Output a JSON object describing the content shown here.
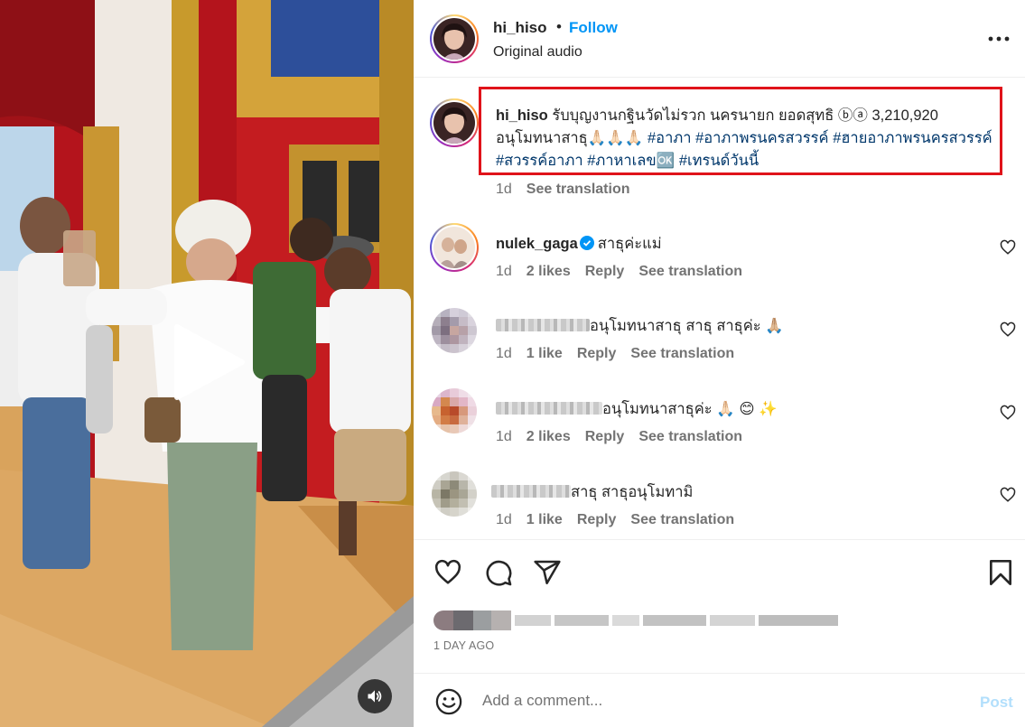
{
  "post": {
    "author": "hi_hiso",
    "follow_label": "Follow",
    "audio": "Original audio",
    "more_icon": "more-horizontal-icon"
  },
  "caption": {
    "username": "hi_hiso",
    "text": " รับบุญงานกฐินวัดไม่รวก นครนายก ยอดสุทธิ ⓑⓐ 3,210,920 อนุโมทนาสาธุ🙏🏻🙏🏻🙏🏻 ",
    "hashtags": [
      "#อาภา",
      "#อาภาพรนครสวรรค์",
      "#ฮายอาภาพรนครสวรรค์",
      "#สวรรค์อาภา",
      "#ภาหาเลข🆗",
      "#เทรนด์วันนี้"
    ],
    "time": "1d",
    "see_translation": "See translation",
    "highlight_color": "#e0131a"
  },
  "comments": [
    {
      "username": "nulek_gaga",
      "verified": true,
      "text": "สาธุค่ะแม่",
      "time": "1d",
      "likes": "2 likes",
      "reply": "Reply",
      "see_translation": "See translation"
    },
    {
      "username": "",
      "text": "อนุโมทนาสาธุ สาธุ สาธุค่ะ 🙏🏼",
      "time": "1d",
      "likes": "1 like",
      "reply": "Reply",
      "see_translation": "See translation"
    },
    {
      "username": "",
      "text": "อนุโมทนาสาธุค่ะ 🙏🏻 😊 ✨",
      "time": "1d",
      "likes": "2 likes",
      "reply": "Reply",
      "see_translation": "See translation"
    },
    {
      "username": "",
      "text": "สาธุ สาธุอนุโมทามิ",
      "time": "1d",
      "likes": "1 like",
      "reply": "Reply",
      "see_translation": "See translation"
    }
  ],
  "actions": {
    "icons": [
      "heart-icon",
      "comment-icon",
      "share-icon",
      "bookmark-icon"
    ],
    "time_ago": "1 DAY AGO"
  },
  "comment_box": {
    "placeholder": "Add a comment...",
    "post_label": "Post"
  },
  "colors": {
    "link_blue": "#0095f6",
    "hashtag": "#00376b",
    "secondary_text": "#737373"
  }
}
